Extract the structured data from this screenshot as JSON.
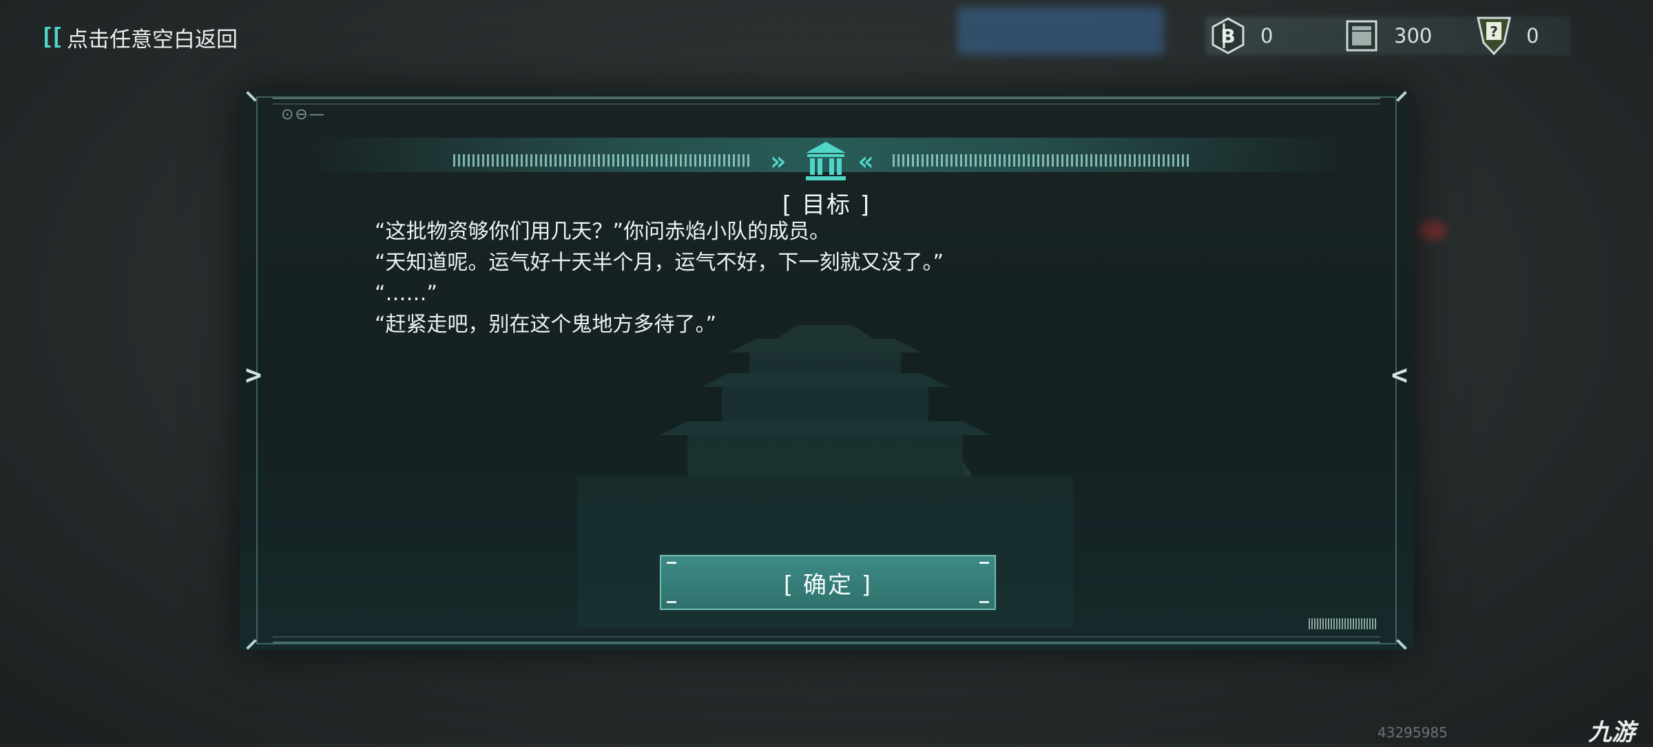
{
  "header": {
    "back_bracket": "[[",
    "back_label": "点击任意空白返回"
  },
  "resources": [
    {
      "icon": "b-coin-hex-icon",
      "value": "0"
    },
    {
      "icon": "supply-crate-icon",
      "value": "300"
    },
    {
      "icon": "question-card-icon",
      "value": "0"
    }
  ],
  "dialog": {
    "indicator": "⊙⊖—",
    "title": "[ 目标 ]",
    "story_lines": [
      "“这批物资够你们用几天？”你问赤焰小队的成员。",
      "“天知道呢。运气好十天半个月，运气不好，下一刻就又没了。”",
      "“……”",
      "“赶紧走吧，别在这个鬼地方多待了。”"
    ],
    "confirm_label": "[ 确定 ]",
    "left_arrow": ">",
    "right_arrow": "<"
  },
  "footer": {
    "id_number": "43295985",
    "logo_text": "九游"
  },
  "colors": {
    "accent": "#4fd6c8",
    "button": "#2f716c",
    "text": "#eef3f2"
  }
}
